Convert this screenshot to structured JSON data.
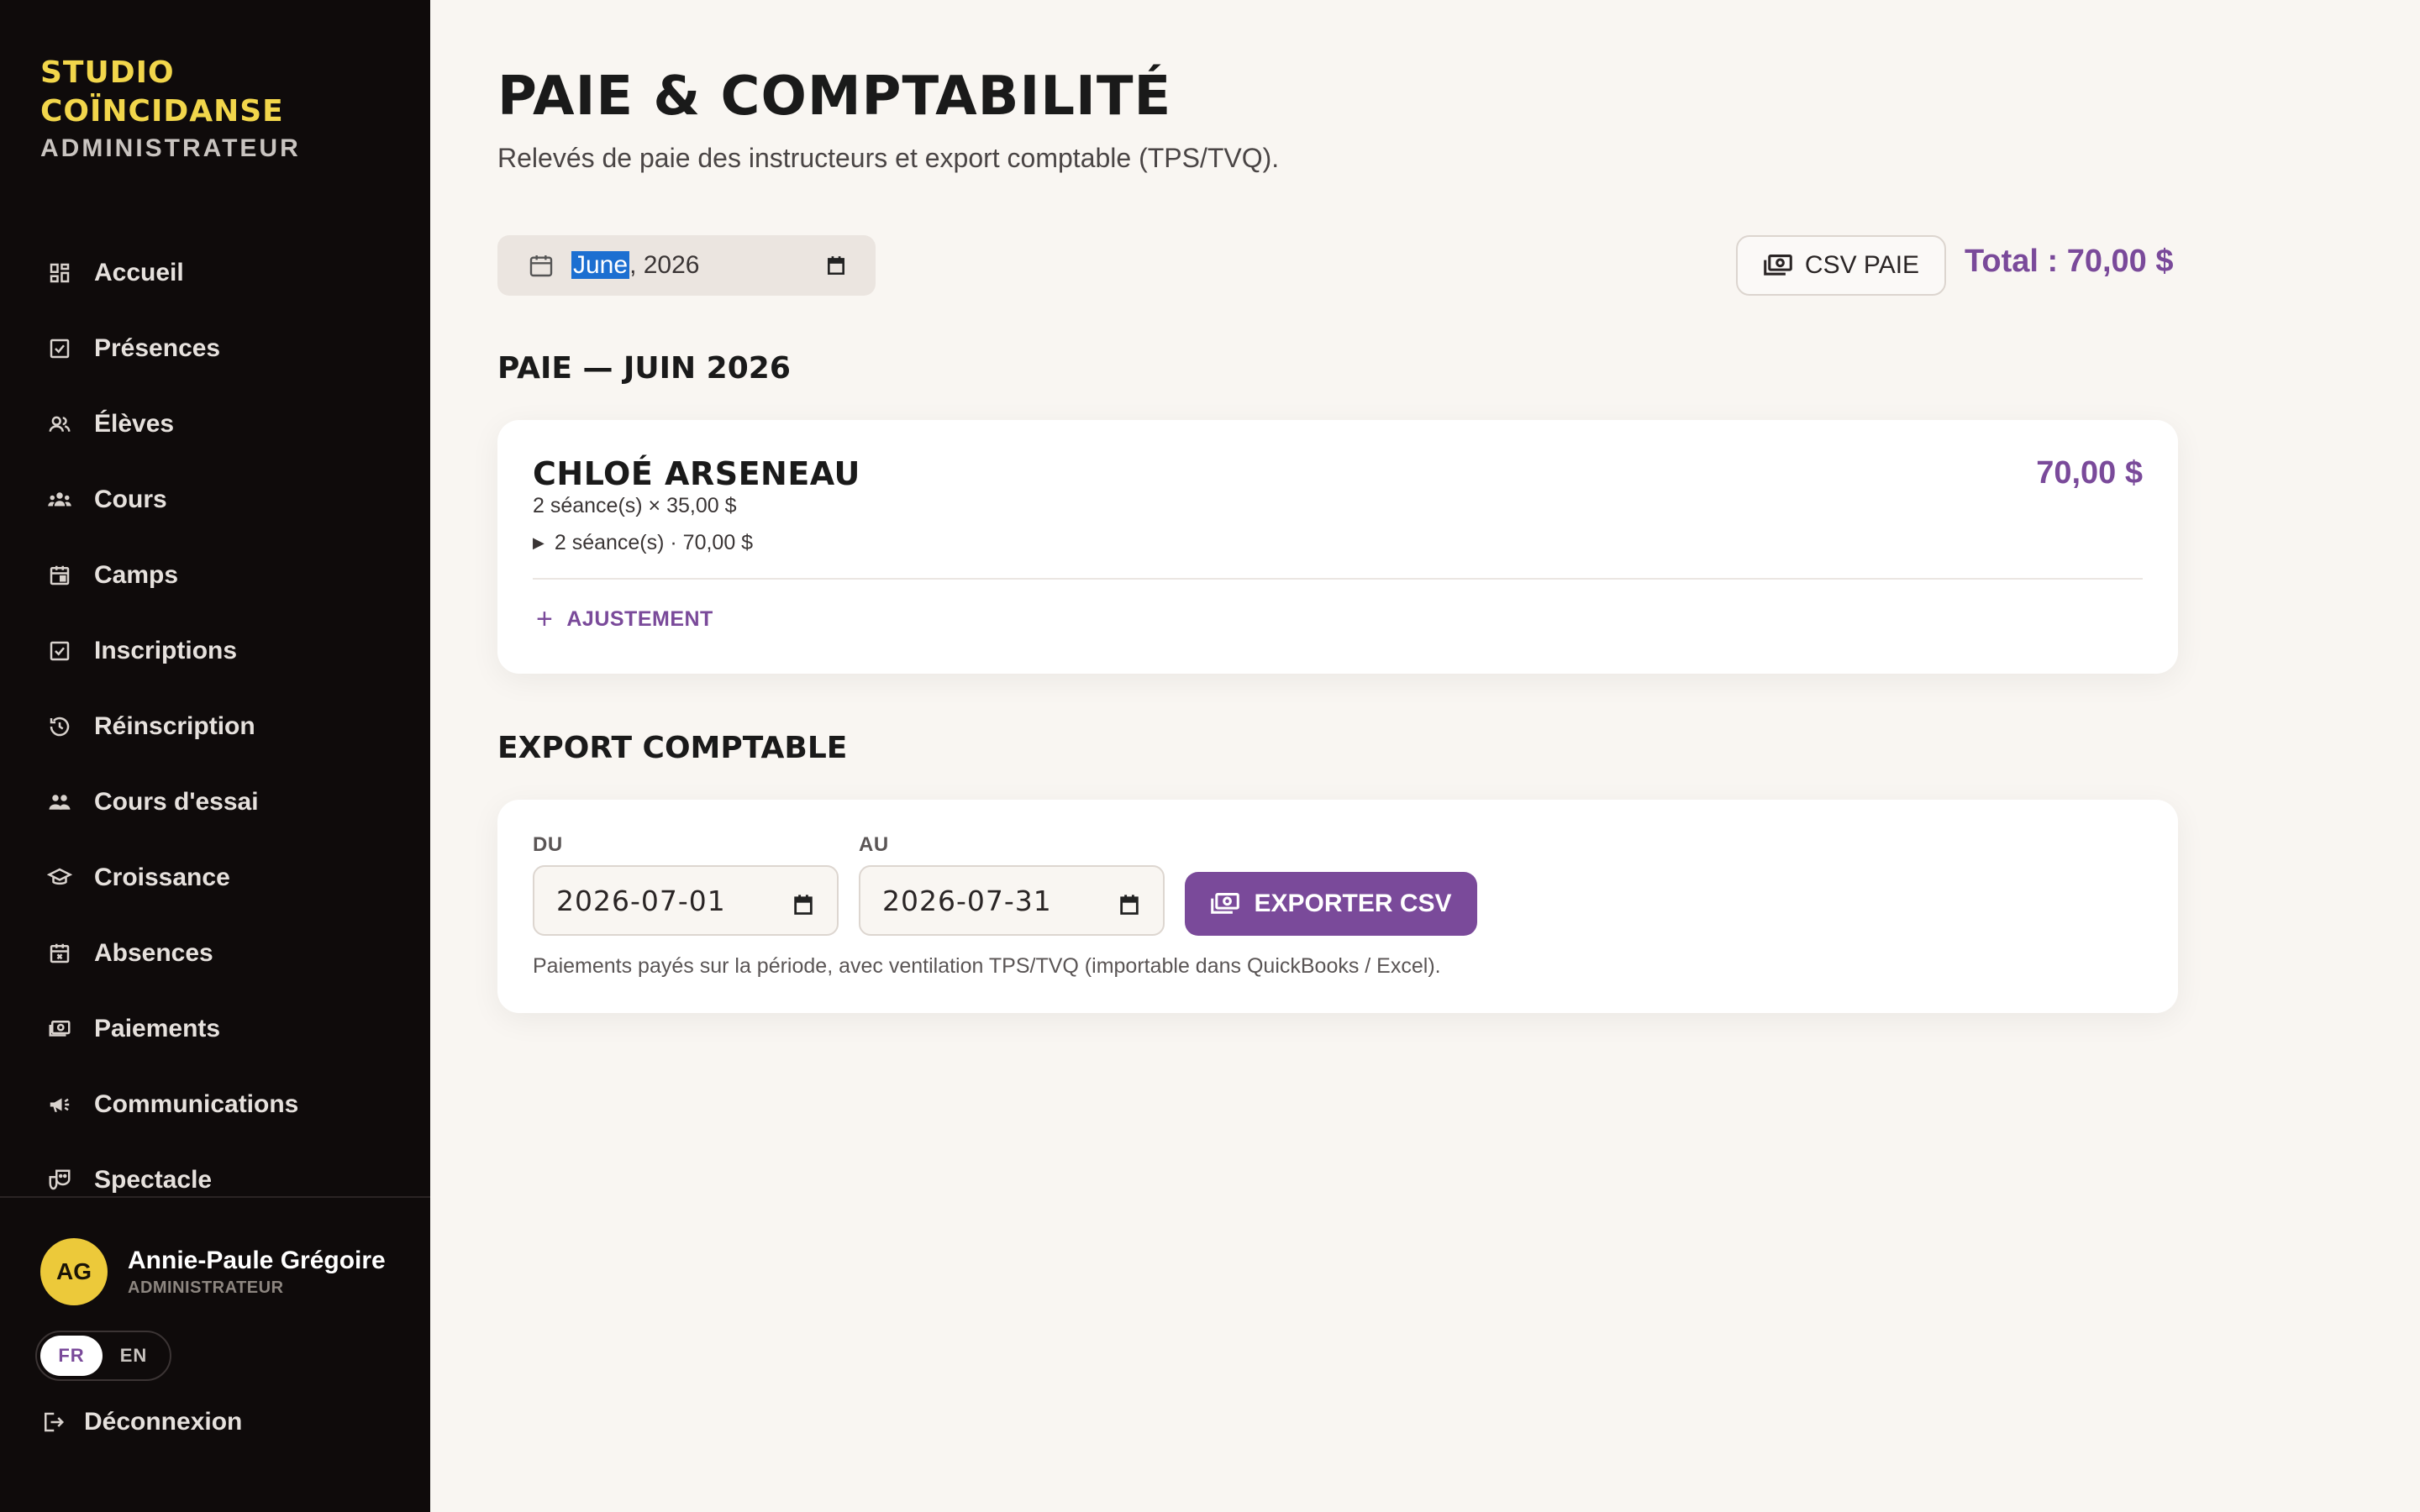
{
  "sidebar": {
    "brand_line1": "STUDIO",
    "brand_line2": "COÏNCIDANSE",
    "role": "ADMINISTRATEUR",
    "items": [
      {
        "label": "Accueil",
        "icon": "dashboard-icon"
      },
      {
        "label": "Présences",
        "icon": "checkbox-icon"
      },
      {
        "label": "Élèves",
        "icon": "users-icon"
      },
      {
        "label": "Cours",
        "icon": "group-icon"
      },
      {
        "label": "Camps",
        "icon": "calendar-icon"
      },
      {
        "label": "Inscriptions",
        "icon": "checklist-icon"
      },
      {
        "label": "Réinscription",
        "icon": "history-icon"
      },
      {
        "label": "Cours d'essai",
        "icon": "people-icon"
      },
      {
        "label": "Croissance",
        "icon": "graduation-icon"
      },
      {
        "label": "Absences",
        "icon": "calendar-x-icon"
      },
      {
        "label": "Paiements",
        "icon": "money-icon"
      },
      {
        "label": "Communications",
        "icon": "megaphone-icon"
      },
      {
        "label": "Spectacle",
        "icon": "theater-icon"
      }
    ],
    "user": {
      "initials": "AG",
      "name": "Annie-Paule Grégoire",
      "role": "ADMINISTRATEUR"
    },
    "lang": {
      "fr": "FR",
      "en": "EN",
      "active": "FR"
    },
    "logout": "Déconnexion"
  },
  "header": {
    "title": "PAIE & COMPTABILITÉ",
    "subtitle": "Relevés de paie des instructeurs et export comptable (TPS/TVQ)."
  },
  "toolbar": {
    "month_highlight": "June",
    "month_rest": ", 2026",
    "csv_label": "CSV PAIE",
    "total": "Total : 70,00 $"
  },
  "payroll": {
    "section_title": "PAIE — JUIN 2026",
    "instructor": {
      "name": "CHLOÉ ARSENEAU",
      "amount": "70,00 $",
      "detail": "2 séance(s) × 35,00 $",
      "summary": "2 séance(s) · 70,00 $"
    },
    "adjust_label": "AJUSTEMENT"
  },
  "export": {
    "section_title": "EXPORT COMPTABLE",
    "from_label": "DU",
    "from_value": "2026-07-01",
    "to_label": "AU",
    "to_value": "2026-07-31",
    "button_label": "EXPORTER CSV",
    "note": "Paiements payés sur la période, avec ventilation TPS/TVQ (importable dans QuickBooks / Excel)."
  },
  "colors": {
    "sidebar_bg": "#0f0b0b",
    "brand": "#f2d64b",
    "accent": "#7a4a9a",
    "page_bg": "#f9f6f2"
  }
}
